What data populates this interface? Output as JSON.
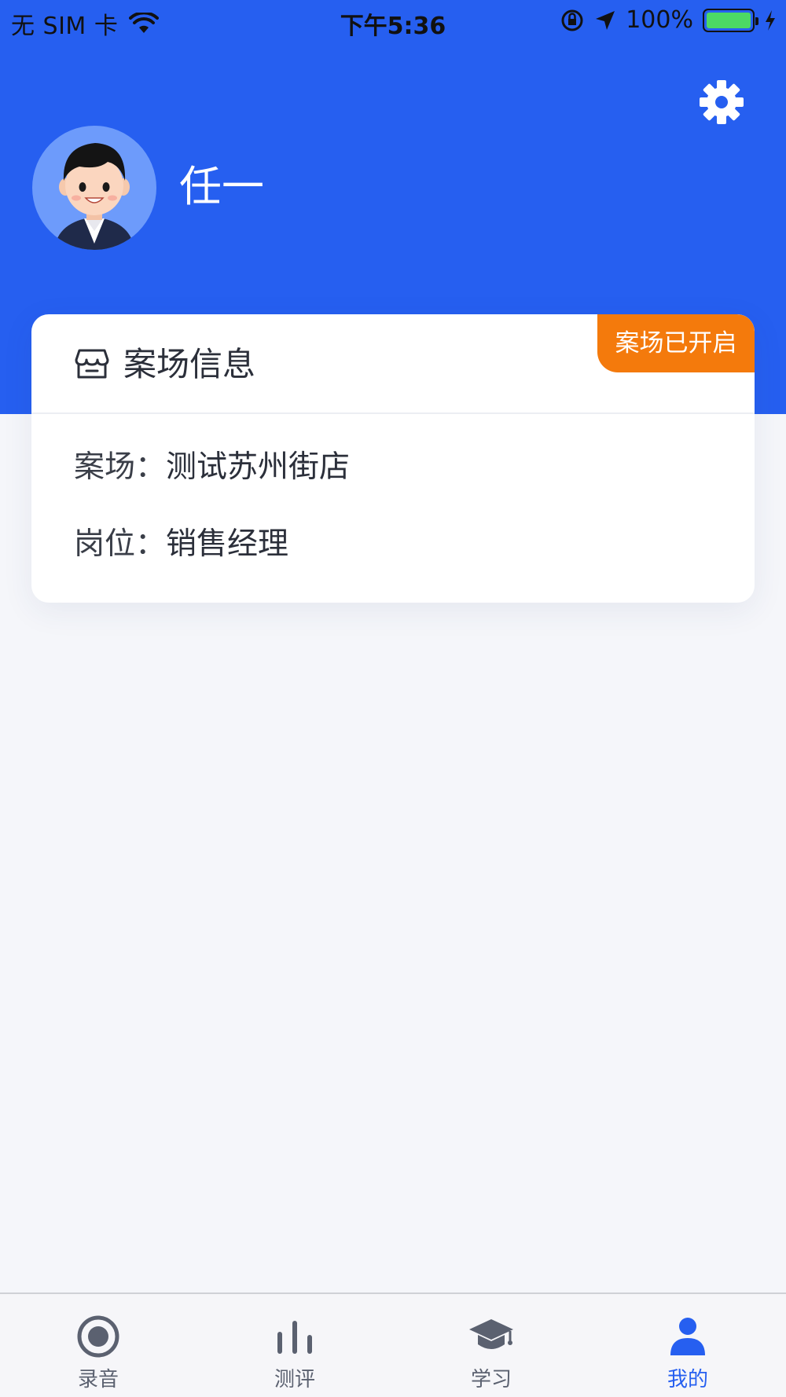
{
  "status_bar": {
    "carrier": "无 SIM 卡",
    "time": "下午5:36",
    "battery": "100%"
  },
  "header": {
    "settings_icon": "gear-icon",
    "user_name": "任一"
  },
  "card": {
    "title": "案场信息",
    "badge": "案场已开启",
    "rows": [
      {
        "label": "案场：",
        "value": "测试苏州街店"
      },
      {
        "label": "岗位：",
        "value": "销售经理"
      }
    ]
  },
  "tabbar": {
    "items": [
      {
        "label": "录音",
        "icon": "record-icon",
        "active": false
      },
      {
        "label": "测评",
        "icon": "bar-chart-icon",
        "active": false
      },
      {
        "label": "学习",
        "icon": "graduation-cap-icon",
        "active": false
      },
      {
        "label": "我的",
        "icon": "person-icon",
        "active": true
      }
    ]
  },
  "colors": {
    "brand_blue": "#265ff0",
    "badge_orange": "#f47a0c",
    "battery_green": "#4cd964",
    "background": "#f5f6fa"
  }
}
